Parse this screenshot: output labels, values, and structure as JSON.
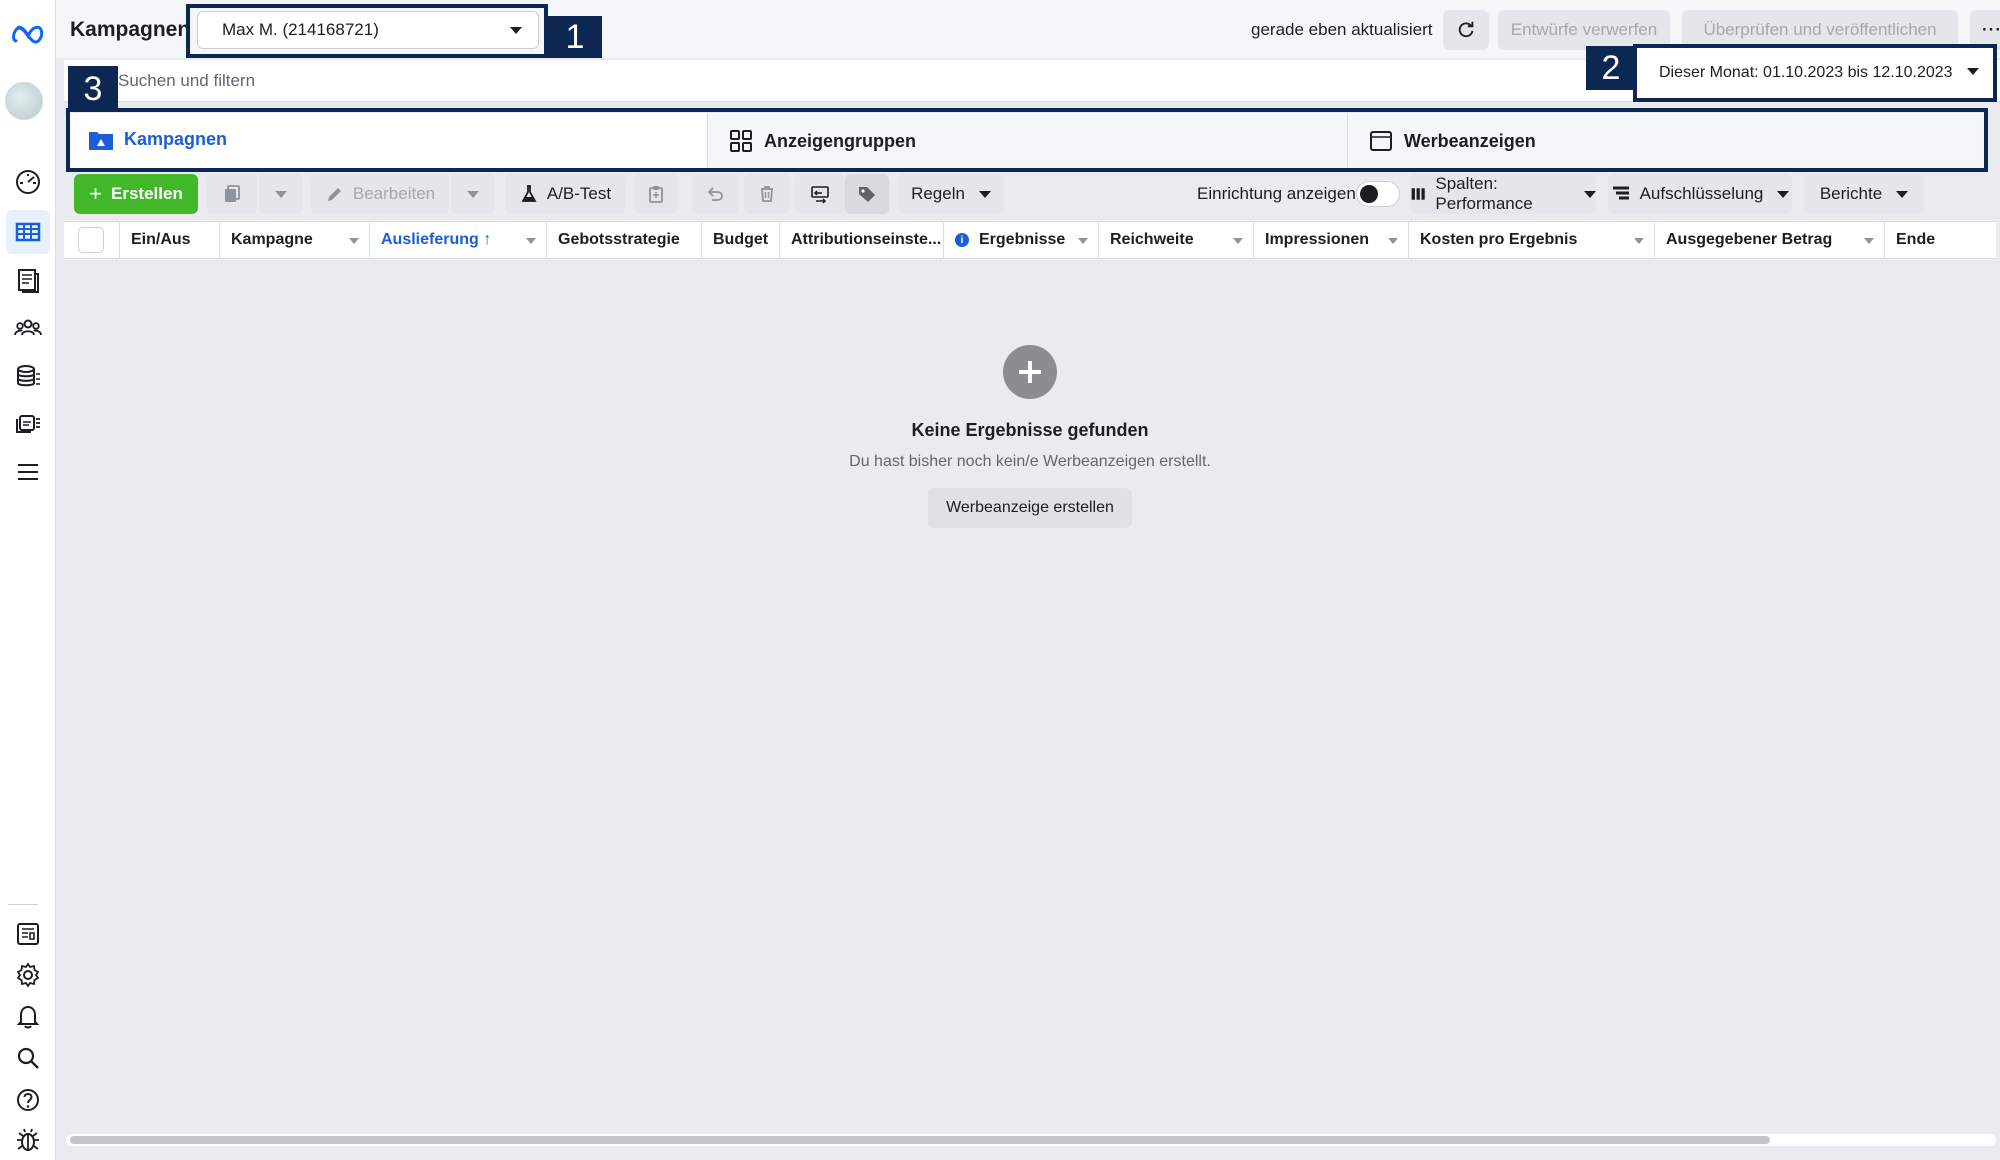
{
  "sidebar": {
    "top_items": [
      {
        "icon": "meta-logo-icon"
      },
      {
        "icon": "avatar"
      },
      {
        "icon": "dashboard-gauge-icon"
      },
      {
        "icon": "campaign-table-icon",
        "active": true
      },
      {
        "icon": "pages-icon"
      },
      {
        "icon": "audiences-icon"
      },
      {
        "icon": "billing-icon"
      },
      {
        "icon": "ad-library-icon"
      },
      {
        "icon": "menu-icon"
      }
    ],
    "bottom_items": [
      {
        "icon": "news-icon"
      },
      {
        "icon": "gear-icon"
      },
      {
        "icon": "bell-icon"
      },
      {
        "icon": "search-icon"
      },
      {
        "icon": "help-icon"
      },
      {
        "icon": "bug-icon"
      }
    ]
  },
  "header": {
    "title": "Kampagnen",
    "account": "Max M.  (214168721)",
    "updated": "gerade eben aktualisiert",
    "discard_label": "Entwürfe verwerfen",
    "publish_label": "Überprüfen und veröffentlichen",
    "more_label": "···"
  },
  "search": {
    "placeholder": "Suchen und filtern",
    "date_range": "Dieser Monat: 01.10.2023 bis 12.10.2023"
  },
  "annotations": [
    "1",
    "2",
    "3"
  ],
  "tabs": [
    {
      "label": "Kampagnen",
      "active": true
    },
    {
      "label": "Anzeigengruppen"
    },
    {
      "label": "Werbeanzeigen"
    }
  ],
  "toolbar": {
    "create_label": "Erstellen",
    "edit_label": "Bearbeiten",
    "abtest_label": "A/B-Test",
    "rules_label": "Regeln",
    "setup_toggle_label": "Einrichtung anzeigen",
    "columns_label": "Spalten: Performance",
    "breakdown_label": "Aufschlüsselung",
    "reports_label": "Berichte"
  },
  "table": {
    "columns": [
      {
        "label": "Ein/Aus"
      },
      {
        "label": "Kampagne",
        "dropdown": true
      },
      {
        "label": "Auslieferung ↑",
        "sorted": true,
        "dropdown": true
      },
      {
        "label": "Gebotsstrategie"
      },
      {
        "label": "Budget"
      },
      {
        "label": "Attributionseinste..."
      },
      {
        "label": "Ergebnisse",
        "info": true,
        "dropdown": true
      },
      {
        "label": "Reichweite",
        "dropdown": true
      },
      {
        "label": "Impressionen",
        "dropdown": true
      },
      {
        "label": "Kosten pro Ergebnis",
        "dropdown": true
      },
      {
        "label": "Ausgegebener Betrag",
        "dropdown": true
      },
      {
        "label": "Ende"
      }
    ]
  },
  "empty_state": {
    "title": "Keine Ergebnisse gefunden",
    "subtitle": "Du hast bisher noch kein/e Werbeanzeigen erstellt.",
    "button_label": "Werbeanzeige erstellen"
  },
  "colors": {
    "accent_blue": "#1a5fd8",
    "create_green": "#42b72a",
    "annotation_navy": "#0c2852"
  }
}
